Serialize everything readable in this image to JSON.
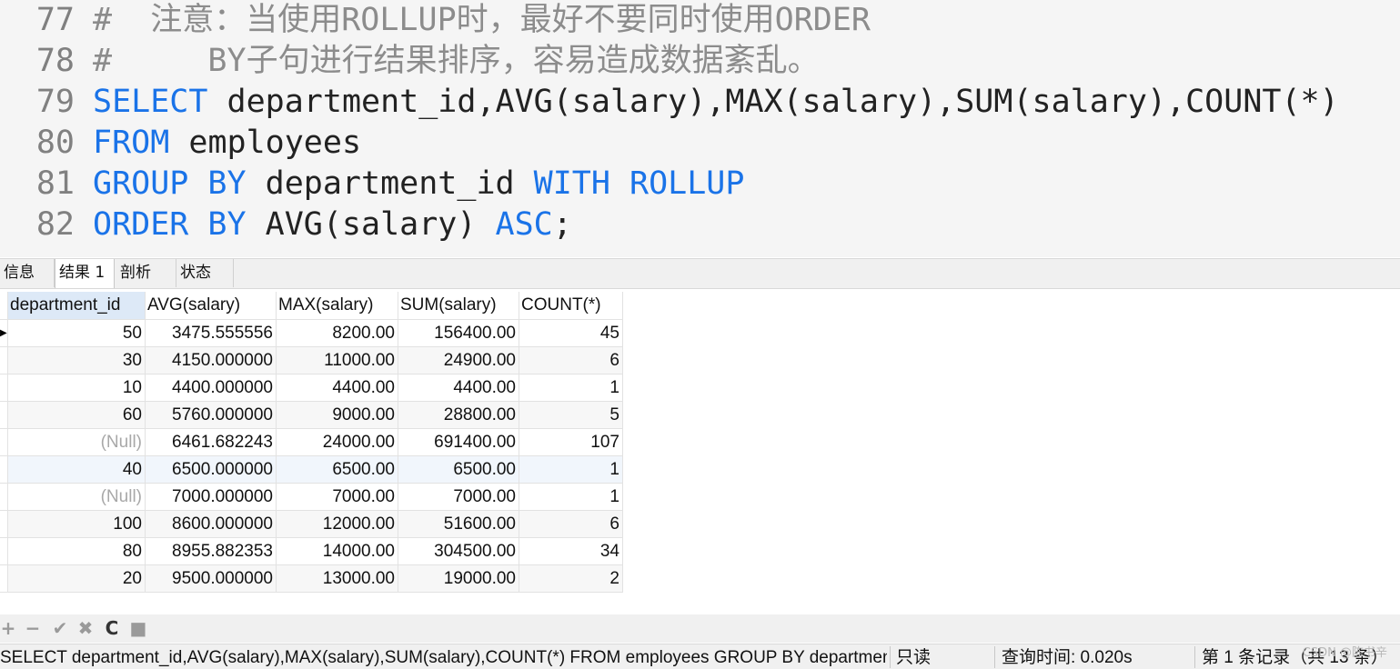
{
  "editor": {
    "lines": [
      {
        "num": "77",
        "parts": [
          {
            "t": "#  注意：当使用ROLLUP时，最好不要同时使用ORDER",
            "c": "cm"
          }
        ]
      },
      {
        "num": "78",
        "parts": [
          {
            "t": "#     BY子句进行结果排序，容易造成数据紊乱。",
            "c": "cm"
          }
        ]
      },
      {
        "num": "79",
        "parts": [
          {
            "t": "SELECT",
            "c": "kw"
          },
          {
            "t": " department_id,AVG(salary),MAX(salary),SUM(salary),COUNT(*)",
            "c": "tx"
          }
        ]
      },
      {
        "num": "80",
        "parts": [
          {
            "t": "FROM",
            "c": "kw"
          },
          {
            "t": " employees",
            "c": "tx"
          }
        ]
      },
      {
        "num": "81",
        "parts": [
          {
            "t": "GROUP BY",
            "c": "kw"
          },
          {
            "t": " department_id ",
            "c": "tx"
          },
          {
            "t": "WITH ROLLUP",
            "c": "kw"
          }
        ]
      },
      {
        "num": "82",
        "parts": [
          {
            "t": "ORDER BY",
            "c": "kw"
          },
          {
            "t": " AVG(salary) ",
            "c": "tx"
          },
          {
            "t": "ASC",
            "c": "kw"
          },
          {
            "t": ";",
            "c": "tx"
          }
        ]
      }
    ]
  },
  "tabs": {
    "info": "信息",
    "result1": "结果 1",
    "profile": "剖析",
    "status": "状态"
  },
  "grid": {
    "columns": [
      "department_id",
      "AVG(salary)",
      "MAX(salary)",
      "SUM(salary)",
      "COUNT(*)"
    ],
    "rows": [
      [
        "50",
        "3475.555556",
        "8200.00",
        "156400.00",
        "45"
      ],
      [
        "30",
        "4150.000000",
        "11000.00",
        "24900.00",
        "6"
      ],
      [
        "10",
        "4400.000000",
        "4400.00",
        "4400.00",
        "1"
      ],
      [
        "60",
        "5760.000000",
        "9000.00",
        "28800.00",
        "5"
      ],
      [
        "(Null)",
        "6461.682243",
        "24000.00",
        "691400.00",
        "107"
      ],
      [
        "40",
        "6500.000000",
        "6500.00",
        "6500.00",
        "1"
      ],
      [
        "(Null)",
        "7000.000000",
        "7000.00",
        "7000.00",
        "1"
      ],
      [
        "100",
        "8600.000000",
        "12000.00",
        "51600.00",
        "6"
      ],
      [
        "80",
        "8955.882353",
        "14000.00",
        "304500.00",
        "34"
      ],
      [
        "20",
        "9500.000000",
        "13000.00",
        "19000.00",
        "2"
      ]
    ],
    "current_row_marker": "▶"
  },
  "toolbar": {
    "add": "+",
    "remove": "−",
    "apply": "✔",
    "discard": "✖",
    "refresh": "C",
    "stop": "■"
  },
  "statusbar": {
    "sql": "SELECT department_id,AVG(salary),MAX(salary),SUM(salary),COUNT(*) FROM employees GROUP BY department_id",
    "readonly": "只读",
    "query_time": "查询时间: 0.020s",
    "record": "第 1 条记录（共 13 条）"
  },
  "watermark": "CSDN @陈书辛",
  "colors": {
    "keyword": "#1a73e8",
    "comment": "#8c8c8c",
    "null_text": "#a8a8a8"
  }
}
